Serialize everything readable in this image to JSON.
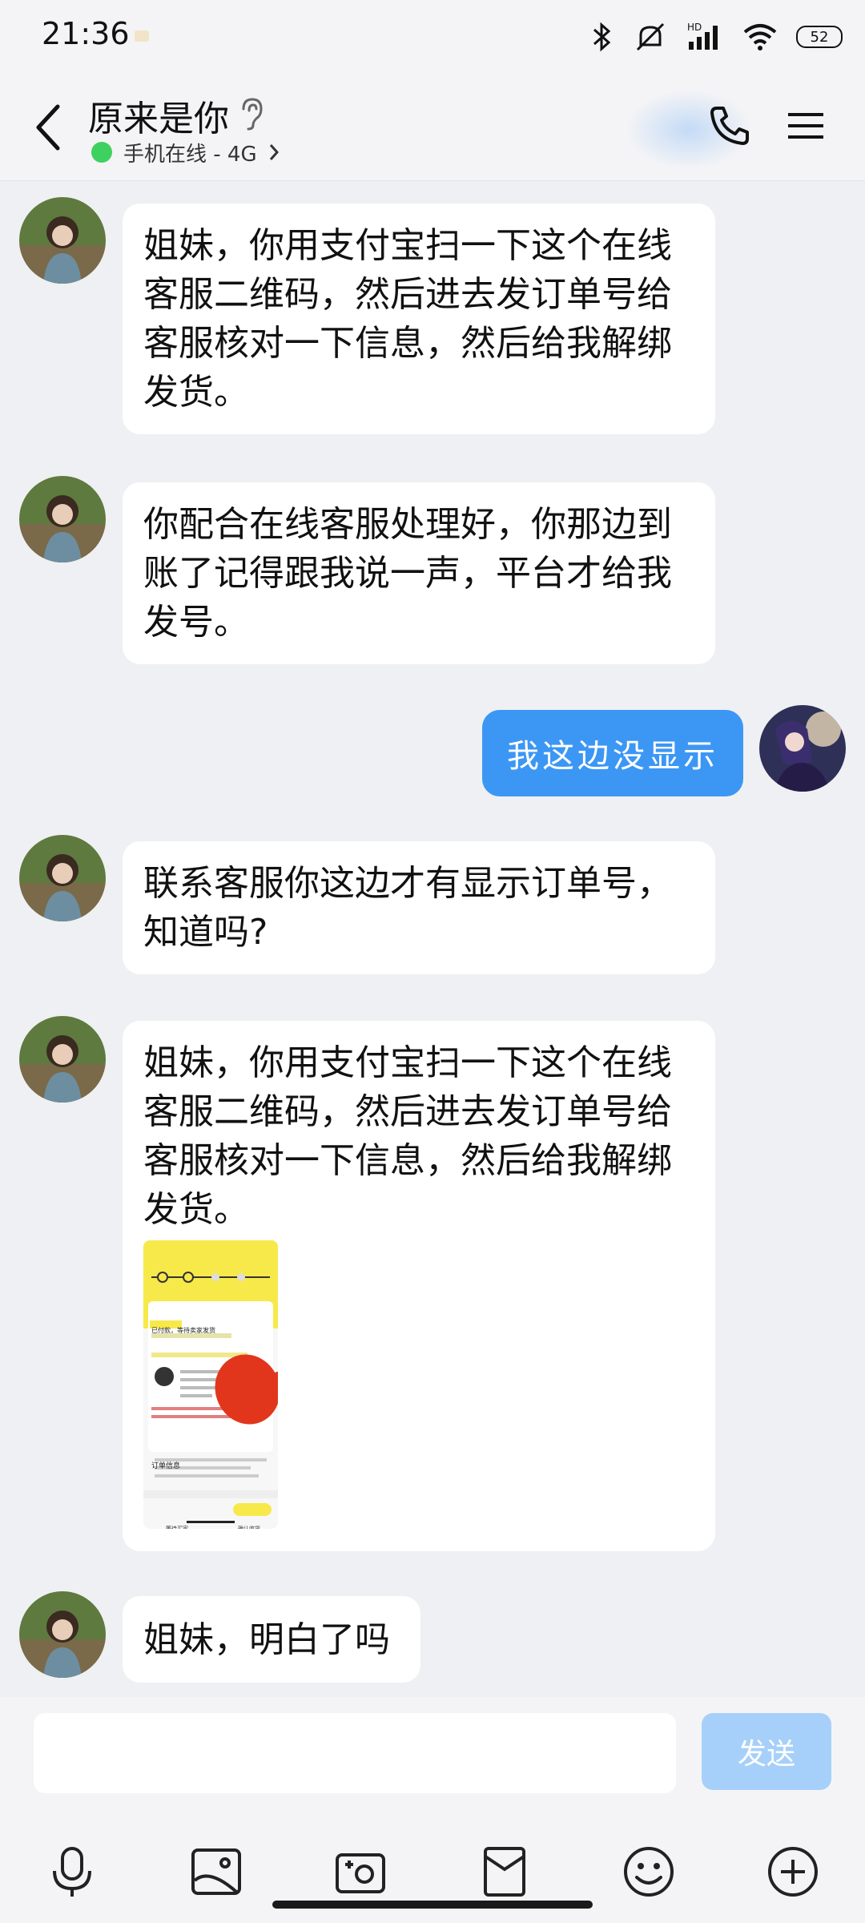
{
  "status_bar": {
    "time": "21:36",
    "battery": "52"
  },
  "header": {
    "contact_name": "原来是你",
    "online_status": "手机在线 - 4G",
    "online_color": "#3fd15f"
  },
  "messages": [
    {
      "side": "in",
      "text": [
        "姐妹，你用支付宝扫一下这个在线",
        "客服二维码，然后进去发订单号给",
        "客服核对一下信息，然后给我解绑",
        "发货。"
      ]
    },
    {
      "side": "in",
      "text": [
        "你配合在线客服处理好，你那边到",
        "账了记得跟我说一声，平台才给我",
        "发号。"
      ]
    },
    {
      "side": "out",
      "text": "我这边没显示",
      "color": "#3c97f4"
    },
    {
      "side": "in",
      "text": [
        "联系客服你这边才有显示订单号，",
        "知道吗?"
      ]
    },
    {
      "side": "in",
      "text": [
        "姐妹，你用支付宝扫一下这个在线",
        "客服二维码，然后进去发订单号给",
        "客服核对一下信息，然后给我解绑",
        "发货。"
      ],
      "has_image": true,
      "image_text": {
        "status": "已付款，等待卖家发货",
        "section": "订单信息",
        "btn_left": "等待买家",
        "btn_right": "确认收货"
      }
    },
    {
      "side": "in",
      "text": "姐妹，明白了吗"
    }
  ],
  "input": {
    "placeholder": "",
    "value": "",
    "send_label": "发送",
    "send_color": "#a6d0fa"
  },
  "toolbar": [
    "microphone-icon",
    "image-icon",
    "camera-icon",
    "red-packet-icon",
    "emoji-icon",
    "plus-icon"
  ]
}
